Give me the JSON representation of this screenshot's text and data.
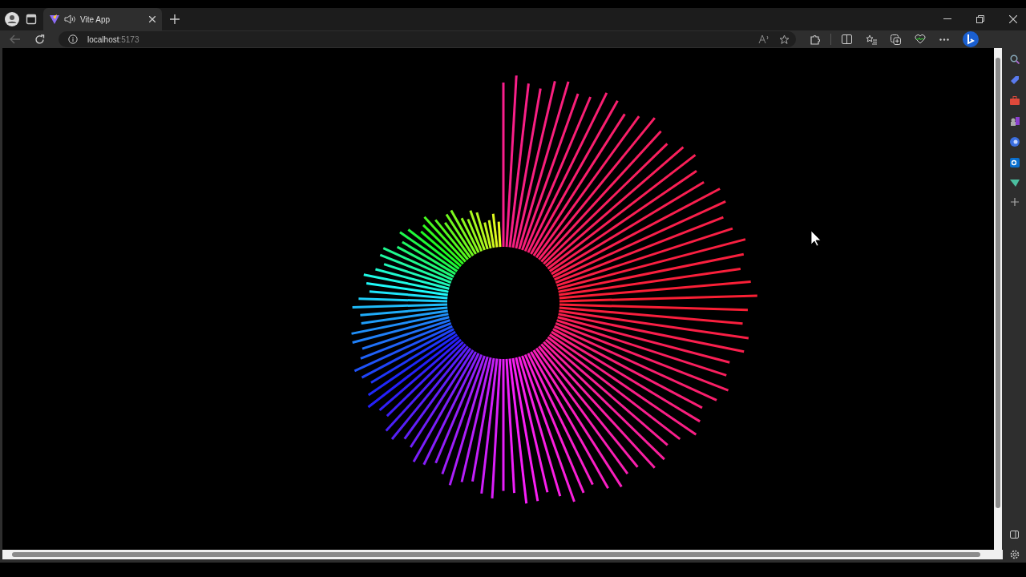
{
  "tabs": [
    {
      "title": "Vite App",
      "selected": true,
      "audio_playing": true
    }
  ],
  "address_bar": {
    "host": "localhost",
    "port": ":5173"
  },
  "page": {
    "kind": "radial-visualizer"
  }
}
